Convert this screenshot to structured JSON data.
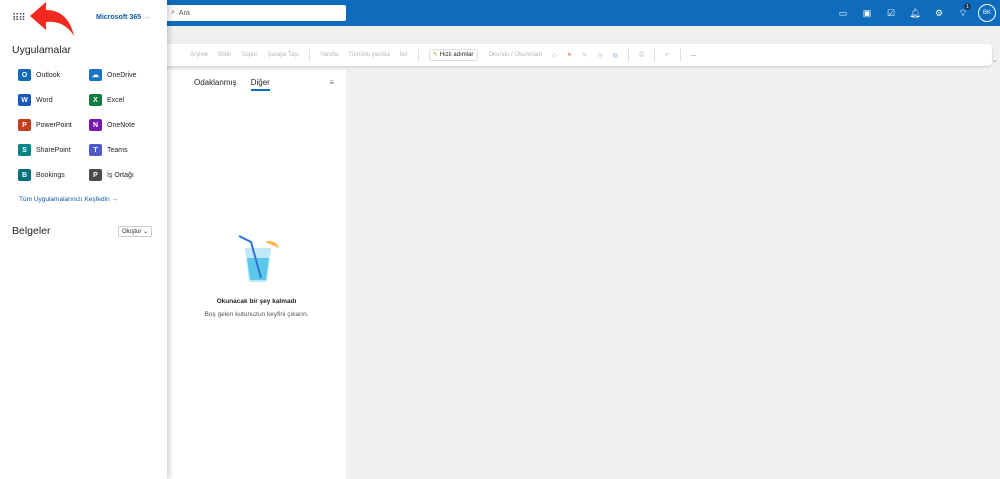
{
  "search": {
    "placeholder": "Ara"
  },
  "topbar": {
    "badge_count": "1",
    "avatar": "BK",
    "icons": [
      "chat-icon",
      "teams-icon",
      "todo-icon",
      "bell-icon",
      "gear-icon",
      "lightbulb-icon"
    ]
  },
  "toolbar": {
    "items": [
      "Arşivle",
      "Bildir",
      "Süpür",
      "Şuraya Taşı",
      "Yanıtla",
      "Tümünü yanıtla",
      "İlet"
    ],
    "quick_steps": "Hızlı adımlar",
    "read_unread": "Okundu / Okunmadı",
    "more": "..."
  },
  "list": {
    "tabs": [
      "Odaklanmış",
      "Diğer"
    ],
    "empty_title": "Okunacak bir şey kalmadı",
    "empty_sub": "Boş gelen kutunuzun keyfini çıkarın."
  },
  "panel": {
    "m365": "Microsoft 365",
    "m365_arrow": "→",
    "apps_heading": "Uygulamalar",
    "apps": [
      {
        "name": "Outlook",
        "letter": "O",
        "color": "#0f6cbd"
      },
      {
        "name": "OneDrive",
        "letter": "☁",
        "color": "#1a73c7"
      },
      {
        "name": "Word",
        "letter": "W",
        "color": "#185abd"
      },
      {
        "name": "Excel",
        "letter": "X",
        "color": "#107c41"
      },
      {
        "name": "PowerPoint",
        "letter": "P",
        "color": "#c43e1c"
      },
      {
        "name": "OneNote",
        "letter": "N",
        "color": "#7719aa"
      },
      {
        "name": "SharePoint",
        "letter": "S",
        "color": "#038387"
      },
      {
        "name": "Teams",
        "letter": "T",
        "color": "#5059c9"
      },
      {
        "name": "Bookings",
        "letter": "B",
        "color": "#00707a"
      },
      {
        "name": "İş Ortağı",
        "letter": "P",
        "color": "#4a4a4a"
      }
    ],
    "explore": "Tüm Uygulamalarınızı Keşfedin →",
    "docs_heading": "Belgeler",
    "create": "Oluştur ⌄"
  }
}
